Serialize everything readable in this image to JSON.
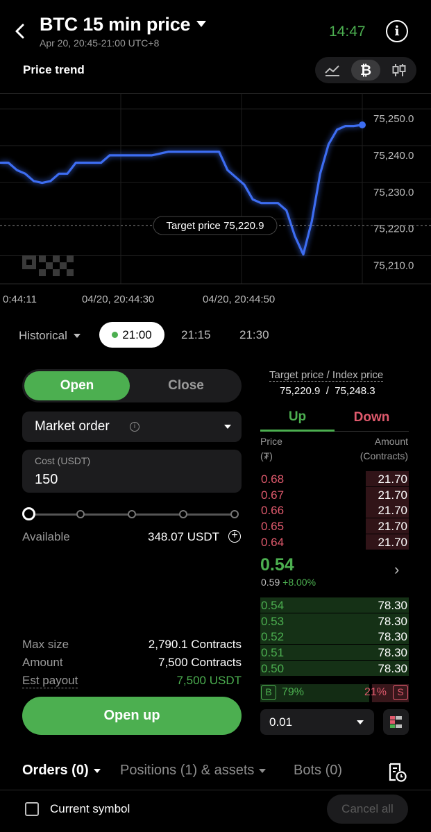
{
  "header": {
    "back_icon": "chevron-left-icon",
    "title": "BTC 15 min price",
    "subtitle": "Apr 20, 20:45-21:00 UTC+8",
    "clock": "14:47",
    "info_icon": "info-icon",
    "trend_label": "Price trend",
    "view_modes": [
      "line-chart-icon",
      "bitcoin-icon",
      "candlestick-icon"
    ],
    "selected_view_mode": "bitcoin-icon"
  },
  "chart": {
    "target_label": "Target price 75,220.9",
    "watermark": "OKX",
    "x_labels": [
      "0:44:11",
      "04/20, 20:44:30",
      "04/20, 20:44:50"
    ]
  },
  "chart_data": {
    "type": "line",
    "title": "",
    "y_ticks": [
      "75,250.0",
      "75,240.0",
      "75,230.0",
      "75,220.0",
      "75,210.0"
    ],
    "ylim": [
      75205,
      75257
    ],
    "target_price": 75220.9,
    "grid": true,
    "series": [
      {
        "color": "#3d6df2",
        "y": [
          75238,
          75238,
          75236,
          75235,
          75233,
          75232.5,
          75233,
          75235,
          75235,
          75238,
          75238,
          75238,
          75238,
          75240,
          75240,
          75240,
          75240,
          75240,
          75240,
          75240.5,
          75241,
          75241,
          75241,
          75241,
          75241,
          75241,
          75241,
          75236,
          75234,
          75232,
          75228,
          75227,
          75227,
          75227,
          75225,
          75218,
          75213,
          75222,
          75235,
          75243,
          75247,
          75248,
          75248,
          75248.3
        ]
      }
    ]
  },
  "time_tabs": {
    "historical": "Historical",
    "items": [
      "21:00",
      "21:15",
      "21:30"
    ],
    "selected": "21:00"
  },
  "order_form": {
    "open_label": "Open",
    "close_label": "Close",
    "order_type": "Market order",
    "cost_label": "Cost (USDT)",
    "cost_value": "150",
    "slider_value": 0,
    "available_label": "Available",
    "available_value": "348.07 USDT",
    "max_size_label": "Max size",
    "max_size_value": "2,790.1 Contracts",
    "amount_label": "Amount",
    "amount_value": "7,500 Contracts",
    "payout_label": "Est payout",
    "payout_value": "7,500 USDT",
    "submit_label": "Open up"
  },
  "order_book": {
    "target_index_label": "Target price / Index price",
    "target_index_value": "75,220.9  /  75,248.3",
    "up_label": "Up",
    "down_label": "Down",
    "price_header": "Price",
    "price_unit": "(₮)",
    "amount_header": "Amount",
    "amount_unit": "(Contracts)",
    "asks": [
      {
        "price": "0.68",
        "amount": "21.70"
      },
      {
        "price": "0.67",
        "amount": "21.70"
      },
      {
        "price": "0.66",
        "amount": "21.70"
      },
      {
        "price": "0.65",
        "amount": "21.70"
      },
      {
        "price": "0.64",
        "amount": "21.70"
      }
    ],
    "last_price": "0.54",
    "last_ref": "0.59",
    "last_change": "+8.00%",
    "bids": [
      {
        "price": "0.54",
        "amount": "78.30"
      },
      {
        "price": "0.53",
        "amount": "78.30"
      },
      {
        "price": "0.52",
        "amount": "78.30"
      },
      {
        "price": "0.51",
        "amount": "78.30"
      },
      {
        "price": "0.50",
        "amount": "78.30"
      }
    ],
    "buy_badge": "B",
    "buy_pct": "79%",
    "sell_pct": "21%",
    "sell_badge": "S",
    "precision": "0.01"
  },
  "bottom": {
    "tabs": [
      {
        "label": "Orders",
        "count": "(0)"
      },
      {
        "label": "Positions (1) & assets",
        "count": ""
      },
      {
        "label": "Bots",
        "count": "(0)"
      }
    ],
    "current_symbol_label": "Current symbol",
    "cancel_all_label": "Cancel all"
  },
  "colors": {
    "up": "#4caf50",
    "down": "#e05a6d",
    "line": "#3d6df2"
  }
}
